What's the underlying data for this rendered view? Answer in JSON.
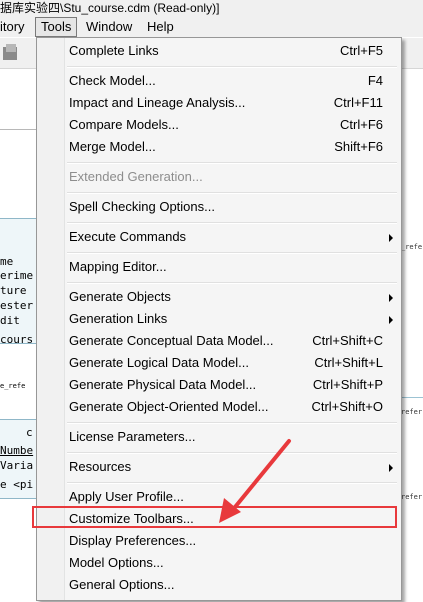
{
  "window": {
    "title": "据库实验四\\Stu_course.cdm (Read-only)]"
  },
  "menubar": [
    {
      "label": "itory"
    },
    {
      "label": "Tools"
    },
    {
      "label": "Window"
    },
    {
      "label": "Help"
    }
  ],
  "menu": {
    "items": [
      {
        "label": "Complete Links",
        "shortcut": "Ctrl+F5"
      },
      {
        "label": "Check Model...",
        "shortcut": "F4"
      },
      {
        "label": "Impact and Lineage Analysis...",
        "shortcut": "Ctrl+F11"
      },
      {
        "label": "Compare Models...",
        "shortcut": "Ctrl+F6"
      },
      {
        "label": "Merge Model...",
        "shortcut": "Shift+F6"
      },
      {
        "label": "Extended Generation..."
      },
      {
        "label": "Spell Checking Options..."
      },
      {
        "label": "Execute Commands"
      },
      {
        "label": "Mapping Editor..."
      },
      {
        "label": "Generate Objects"
      },
      {
        "label": "Generation Links"
      },
      {
        "label": "Generate Conceptual Data Model...",
        "shortcut": "Ctrl+Shift+C"
      },
      {
        "label": "Generate Logical Data Model...",
        "shortcut": "Ctrl+Shift+L"
      },
      {
        "label": "Generate Physical Data Model...",
        "shortcut": "Ctrl+Shift+P"
      },
      {
        "label": "Generate Object-Oriented Model...",
        "shortcut": "Ctrl+Shift+O"
      },
      {
        "label": "License Parameters..."
      },
      {
        "label": "Resources"
      },
      {
        "label": "Apply User Profile..."
      },
      {
        "label": "Customize Toolbars..."
      },
      {
        "label": "Display Preferences..."
      },
      {
        "label": "Model Options..."
      },
      {
        "label": "General Options..."
      }
    ]
  },
  "background": {
    "left_fragments": [
      "me",
      "erime",
      "ture",
      "ester",
      "dit",
      "cours",
      "e_refe",
      "c",
      "Numbe",
      "Varia",
      "e <pi"
    ],
    "right_fragments": [
      "_refe",
      "refer",
      "refer"
    ]
  },
  "colors": {
    "highlight": "#e8393c",
    "menu_bg": "#f5f5f5",
    "disabled_text": "#8d8d8d"
  }
}
